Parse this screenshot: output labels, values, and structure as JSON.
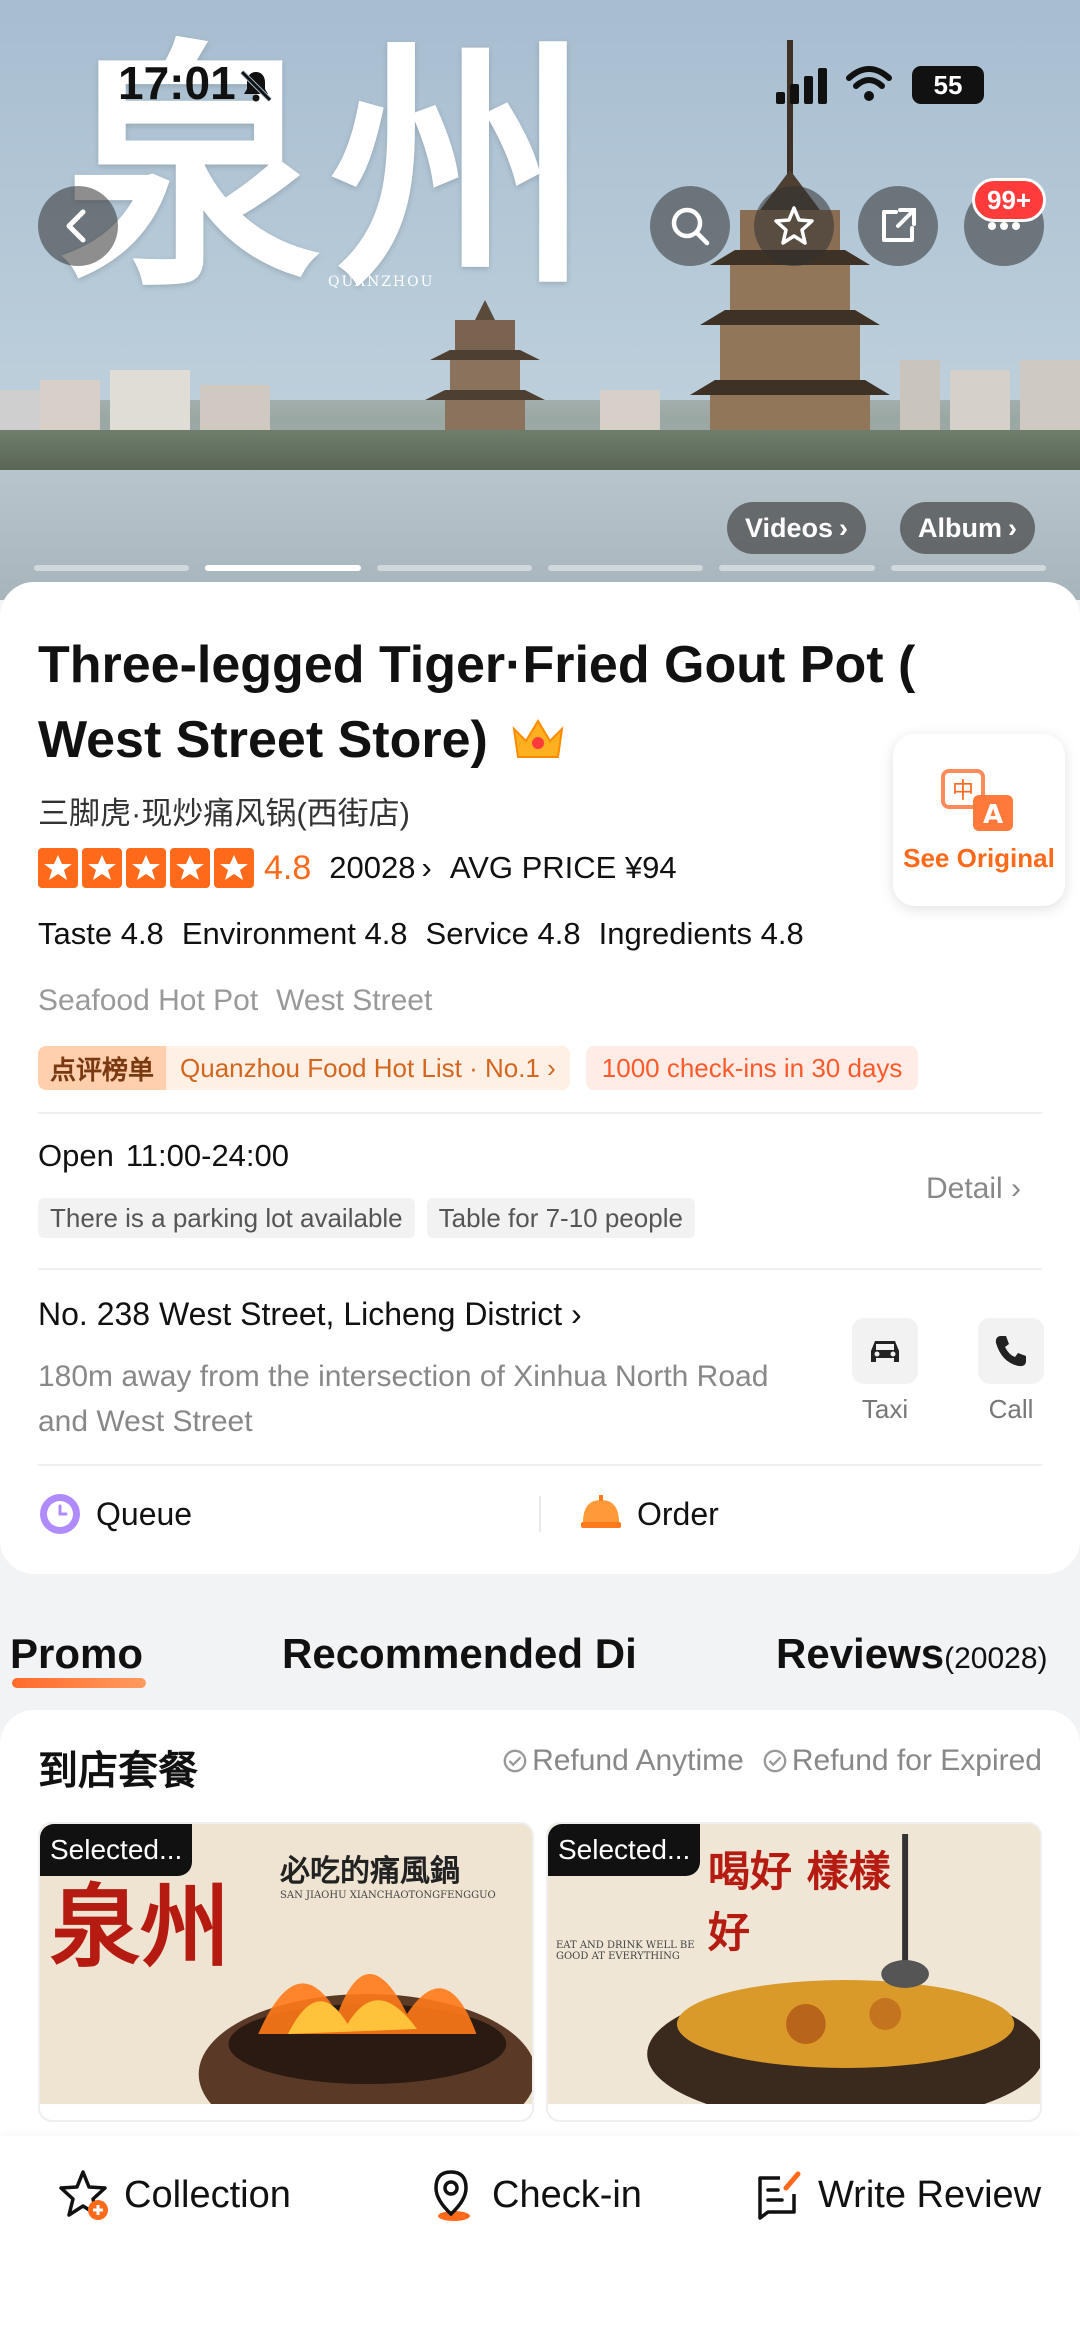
{
  "status": {
    "time": "17:01",
    "battery": "55"
  },
  "hero": {
    "calligraphy": "泉州",
    "calligraphy_sub": "QUANZHOU",
    "notification_badge": "99+",
    "videos_label": "Videos",
    "album_label": "Album",
    "slide_count": 6,
    "active_slide": 1
  },
  "shop": {
    "name": "Three-legged Tiger·Fried Gout Pot ( West Street Store)",
    "native_name": "三脚虎·现炒痛风锅(西街店)",
    "see_original": "See Original",
    "rating": "4.8",
    "review_count": "20028",
    "avg_price": "AVG PRICE ¥94",
    "subscores": [
      "Taste 4.8",
      "Environment 4.8",
      "Service 4.8",
      "Ingredients 4.8"
    ],
    "categories": [
      "Seafood Hot Pot",
      "West Street"
    ],
    "hotlist_label": "点评榜单",
    "hotlist_text": "Quanzhou Food Hot List · No.1",
    "checkins": "1000 check-ins in 30 days",
    "open_label": "Open",
    "open_hours": "11:00-24:00",
    "amenities": [
      "There is a parking lot available",
      "Table for 7-10 people"
    ],
    "detail_label": "Detail",
    "address": "No. 238 West Street, Licheng District",
    "address_sub": "180m away from the intersection of Xinhua North Road and West Street",
    "taxi_label": "Taxi",
    "call_label": "Call",
    "queue_label": "Queue",
    "order_label": "Order"
  },
  "tabs": {
    "promo": "Promo",
    "recommended": "Recommended Di",
    "reviews": "Reviews",
    "reviews_count": "(20028)"
  },
  "deals": {
    "title": "到店套餐",
    "refund_anytime": "Refund Anytime",
    "refund_expired": "Refund for Expired",
    "items": [
      {
        "badge": "Selected...",
        "caption": "必吃的痛風鍋",
        "caption_sub": "SAN JIAOHU XIANCHAOTONGFENGGUO",
        "logo": "泉州"
      },
      {
        "badge": "Selected...",
        "caption": "喝好 樣樣好",
        "caption_sub": "EAT AND DRINK WELL BE GOOD AT EVERYTHING"
      }
    ]
  },
  "bottombar": {
    "collection": "Collection",
    "checkin": "Check-in",
    "review": "Write Review"
  },
  "colors": {
    "accent": "#ff6a1a",
    "badge_red": "#ff3b3b",
    "queue_purple": "#b08bff"
  }
}
